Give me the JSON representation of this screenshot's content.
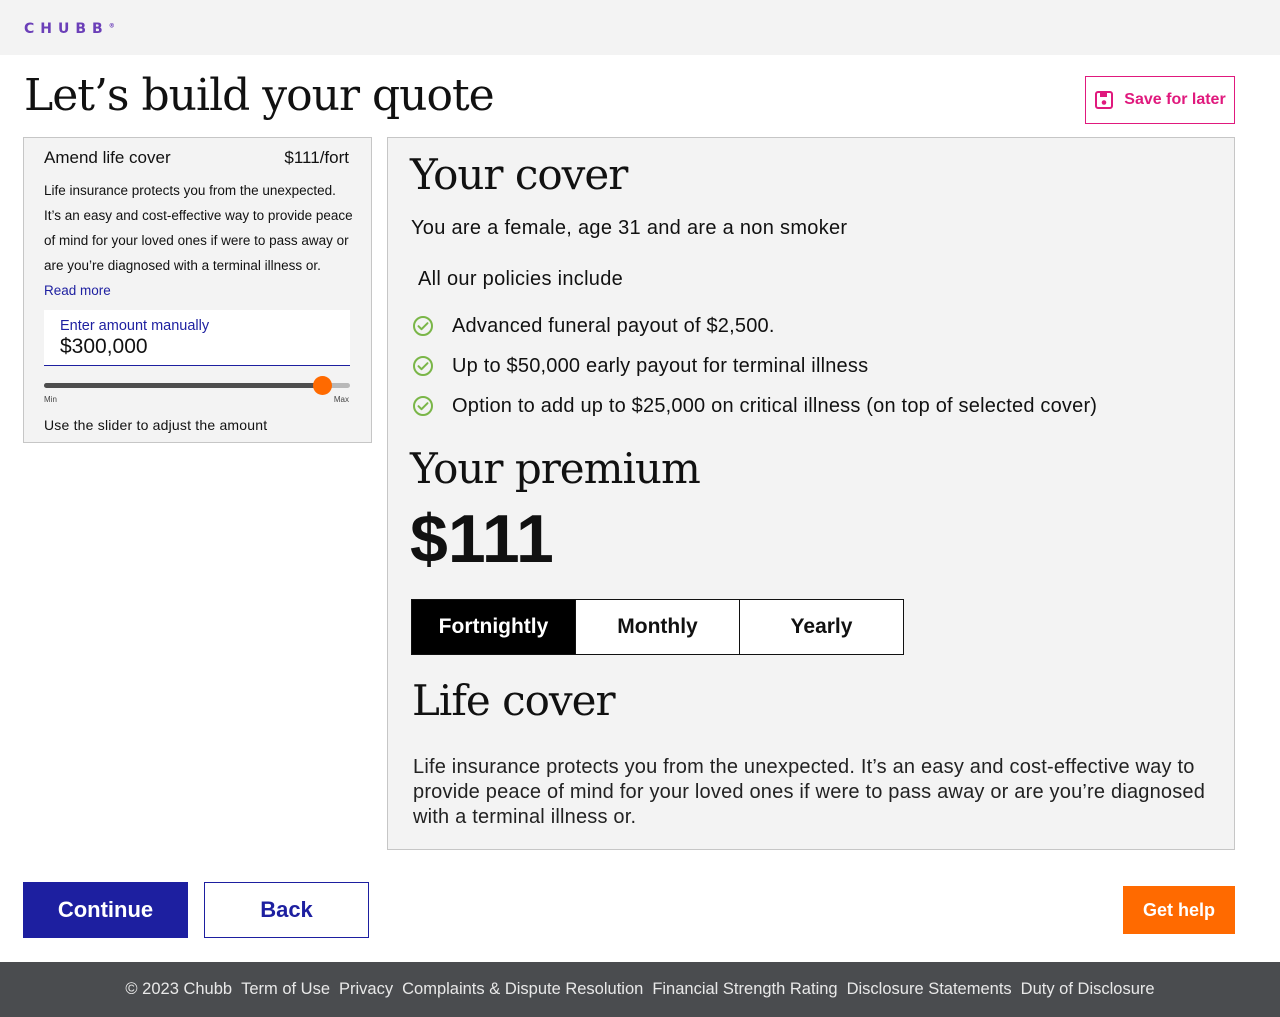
{
  "header": {
    "logo": "CHUBB",
    "logo_mark": "®"
  },
  "page": {
    "title": "Let’s build your quote",
    "save_label": "Save for later"
  },
  "amend": {
    "title": "Amend life cover",
    "price": "$111/fort",
    "description": "Life insurance protects you from the unexpected. It’s an easy and cost-effective way to provide peace of mind for your loved ones if were to pass away or are you’re diagnosed with a terminal illness or.",
    "read_more": "Read more",
    "input_label": "Enter amount manually",
    "input_value": "$300,000",
    "slider_level": 0.91,
    "slider_min": "Min",
    "slider_max": "Max",
    "slider_hint": "Use the slider to adjust the amount"
  },
  "cover": {
    "title": "Your cover",
    "subtitle": "You are a female, age 31 and are a non smoker",
    "policies_title": "All our policies include",
    "policies": [
      "Advanced funeral payout of $2,500.",
      "Up to $50,000 early payout for terminal illness",
      "Option to add up to $25,000 on critical illness (on top of selected cover)"
    ],
    "check_color": "#7ab648"
  },
  "premium": {
    "title": "Your premium",
    "amount": "$111",
    "frequencies": [
      "Fortnightly",
      "Monthly",
      "Yearly"
    ],
    "selected": "Fortnightly"
  },
  "life_cover": {
    "title": "Life cover",
    "description": "Life insurance protects you from the unexpected. It’s an easy and cost-effective way to provide peace of mind for your loved ones if were to pass away or are you’re diagnosed with a terminal illness or."
  },
  "actions": {
    "continue": "Continue",
    "back": "Back",
    "help": "Get help"
  },
  "footer": {
    "copyright": "© 2023 Chubb",
    "links": [
      "Term of Use",
      "Privacy",
      "Complaints & Dispute Resolution",
      "Financial Strength Rating",
      "Disclosure Statements",
      "Duty of Disclosure"
    ]
  },
  "colors": {
    "brand_purple": "#6b3fb8",
    "primary_blue": "#1d1fa0",
    "accent_pink": "#e0197d",
    "accent_orange": "#ff6a00"
  }
}
